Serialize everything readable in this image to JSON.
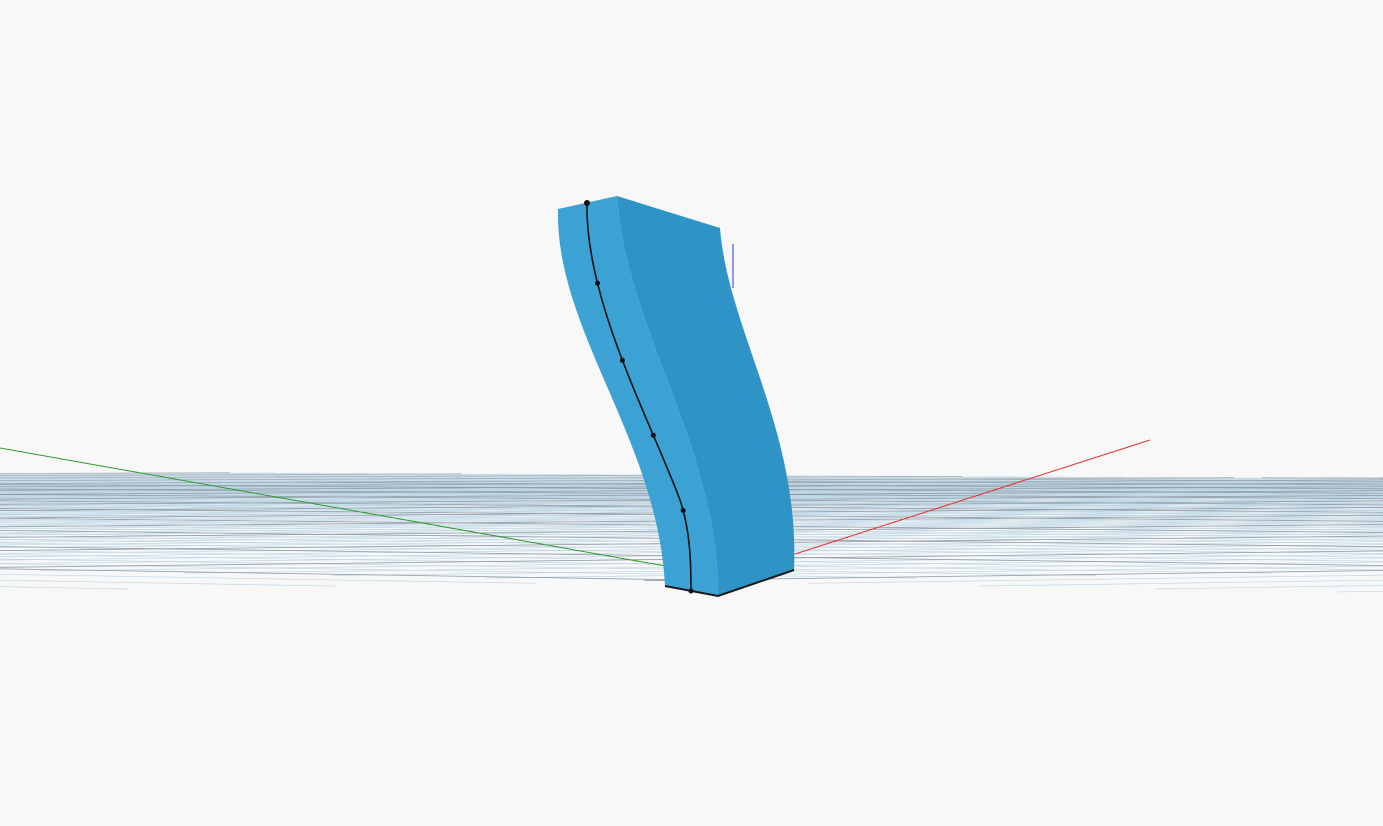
{
  "viewport": {
    "background_color": "#f8f8f8",
    "grid": {
      "visible": true,
      "minor_color": "#b8d4e4",
      "major_color": "#8a8f96"
    },
    "axes": {
      "x_axis_color": "#e8302c",
      "y_axis_color": "#2e9a2e",
      "z_axis_color": "#2a3adb"
    },
    "model": {
      "shape": "curved-extruded-column",
      "front_face_color": "#3ca2d4",
      "side_face_color": "#2f94c5",
      "edge_color": "#1a1a1a"
    },
    "curve": {
      "color": "#111111",
      "control_point_count": 6
    }
  }
}
